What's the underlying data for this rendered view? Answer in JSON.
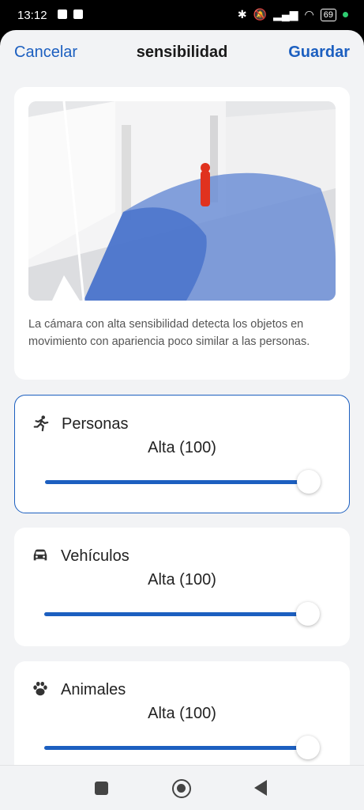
{
  "status_bar": {
    "time": "13:12",
    "battery": "69"
  },
  "header": {
    "cancel_label": "Cancelar",
    "title": "sensibilidad",
    "save_label": "Guardar"
  },
  "info": {
    "description": "La cámara con alta sensibilidad detecta los objetos en movimiento con apariencia poco similar a las personas."
  },
  "sensitivity": [
    {
      "label": "Personas",
      "value_text": "Alta (100)",
      "value": 100,
      "icon": "running-person-icon"
    },
    {
      "label": "Vehículos",
      "value_text": "Alta (100)",
      "value": 100,
      "icon": "car-icon"
    },
    {
      "label": "Animales",
      "value_text": "Alta (100)",
      "value": 100,
      "icon": "paw-icon"
    }
  ],
  "colors": {
    "accent": "#1c5fc0",
    "background": "#f2f3f5"
  }
}
